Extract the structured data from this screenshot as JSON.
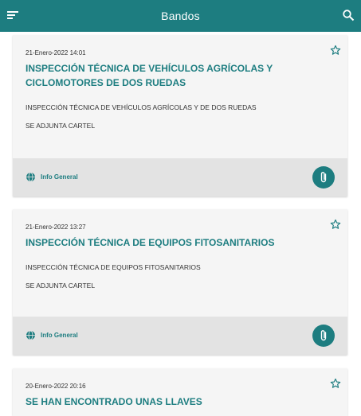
{
  "appbar": {
    "title": "Bandos",
    "menu_icon": "menu-icon",
    "search_icon": "search-icon",
    "color": "#1d7d80"
  },
  "bandos": [
    {
      "date": "21-Enero-2022 14:01",
      "title_line1": "INSPECCIÓN TÉCNICA DE VEHÍCULOS AGRÍCOLAS Y",
      "title_line2": "CICLOMOTORES  DE DOS RUEDAS",
      "body": [
        "INSPECCIÓN TÉCNICA DE VEHÍCULOS AGRÍCOLAS Y DE DOS RUEDAS",
        "SE ADJUNTA CARTEL"
      ],
      "category": "Info General"
    },
    {
      "date": "21-Enero-2022 13:27",
      "title_line1": "INSPECCIÓN TÉCNICA DE EQUIPOS FITOSANITARIOS",
      "body": [
        "INSPECCIÓN TÉCNICA DE EQUIPOS FITOSANITARIOS",
        "SE ADJUNTA CARTEL"
      ],
      "category": "Info General"
    },
    {
      "date": "20-Enero-2022 20:16",
      "title_line1": "SE HAN  ENCONTRADO  UNAS LLAVES"
    }
  ]
}
